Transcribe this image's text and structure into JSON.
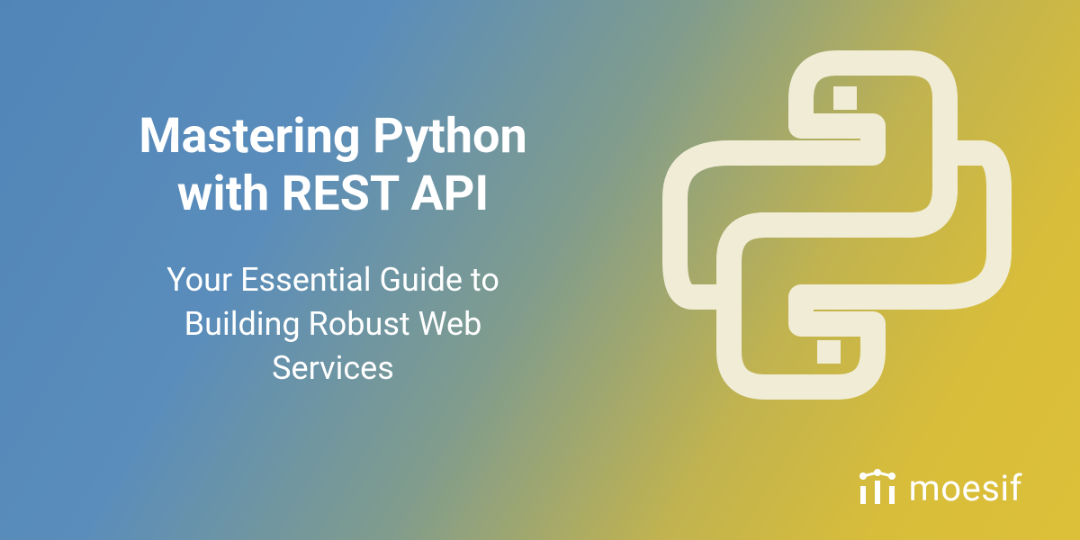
{
  "text": {
    "headline_line1": "Mastering Python",
    "headline_line2": "with REST API",
    "subhead_line1": "Your Essential Guide to",
    "subhead_line2": "Building Robust Web",
    "subhead_line3": "Services"
  },
  "brand": {
    "name": "moesif"
  },
  "colors": {
    "text": "#ffffff",
    "logo": "#f0ecd6"
  }
}
